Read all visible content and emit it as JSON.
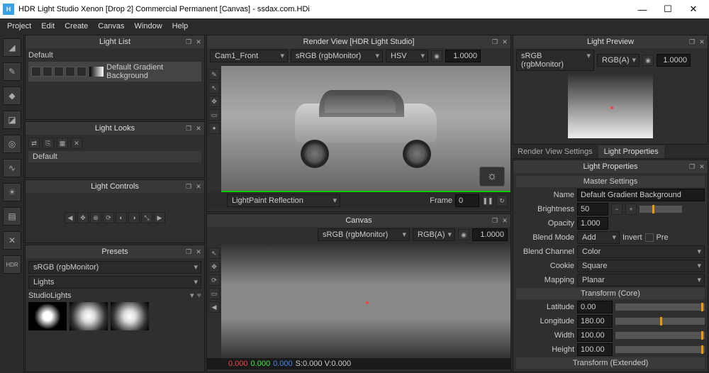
{
  "title": "HDR Light Studio Xenon [Drop 2]  Commercial Permanent [Canvas] - ssdax.com.HDi",
  "menus": [
    "Project",
    "Edit",
    "Create",
    "Canvas",
    "Window",
    "Help"
  ],
  "panels": {
    "lightList": {
      "title": "Light List",
      "default": "Default",
      "item": "Default Gradient Background"
    },
    "lightLooks": {
      "title": "Light Looks",
      "item": "Default"
    },
    "lightControls": {
      "title": "Light Controls"
    },
    "presets": {
      "title": "Presets",
      "colorspace": "sRGB (rgbMonitor)",
      "cat1": "Lights",
      "cat2": "StudioLights"
    },
    "renderView": {
      "title": "Render View [HDR Light Studio]",
      "camera": "Cam1_Front",
      "colorspace": "sRGB (rgbMonitor)",
      "mode": "HSV",
      "exposure": "1.0000",
      "lightpaint": "LightPaint Reflection",
      "frameLabel": "Frame",
      "frame": "0"
    },
    "canvas": {
      "title": "Canvas",
      "colorspace": "sRGB (rgbMonitor)",
      "mode": "RGB(A)",
      "exposure": "1.0000",
      "coords": {
        "r": "0.000",
        "g": "0.000",
        "b": "0.000",
        "sv": "S:0.000 V:0.000"
      }
    },
    "lightPreview": {
      "title": "Light Preview",
      "colorspace": "sRGB (rgbMonitor)",
      "mode": "RGB(A)",
      "exposure": "1.0000"
    },
    "tabs": {
      "rvs": "Render View Settings",
      "lp": "Light Properties"
    },
    "lightProps": {
      "title": "Light Properties",
      "master": "Master Settings",
      "name": {
        "lbl": "Name",
        "val": "Default Gradient Background"
      },
      "brightness": {
        "lbl": "Brightness",
        "val": "50"
      },
      "opacity": {
        "lbl": "Opacity",
        "val": "1.000"
      },
      "blendMode": {
        "lbl": "Blend Mode",
        "val": "Add",
        "invert": "Invert",
        "pre": "Pre"
      },
      "blendChannel": {
        "lbl": "Blend Channel",
        "val": "Color"
      },
      "cookie": {
        "lbl": "Cookie",
        "val": "Square"
      },
      "mapping": {
        "lbl": "Mapping",
        "val": "Planar"
      },
      "transformCore": "Transform (Core)",
      "latitude": {
        "lbl": "Latitude",
        "val": "0.00"
      },
      "longitude": {
        "lbl": "Longitude",
        "val": "180.00"
      },
      "width": {
        "lbl": "Width",
        "val": "100.00"
      },
      "height": {
        "lbl": "Height",
        "val": "100.00"
      },
      "transformExt": "Transform (Extended)"
    }
  }
}
